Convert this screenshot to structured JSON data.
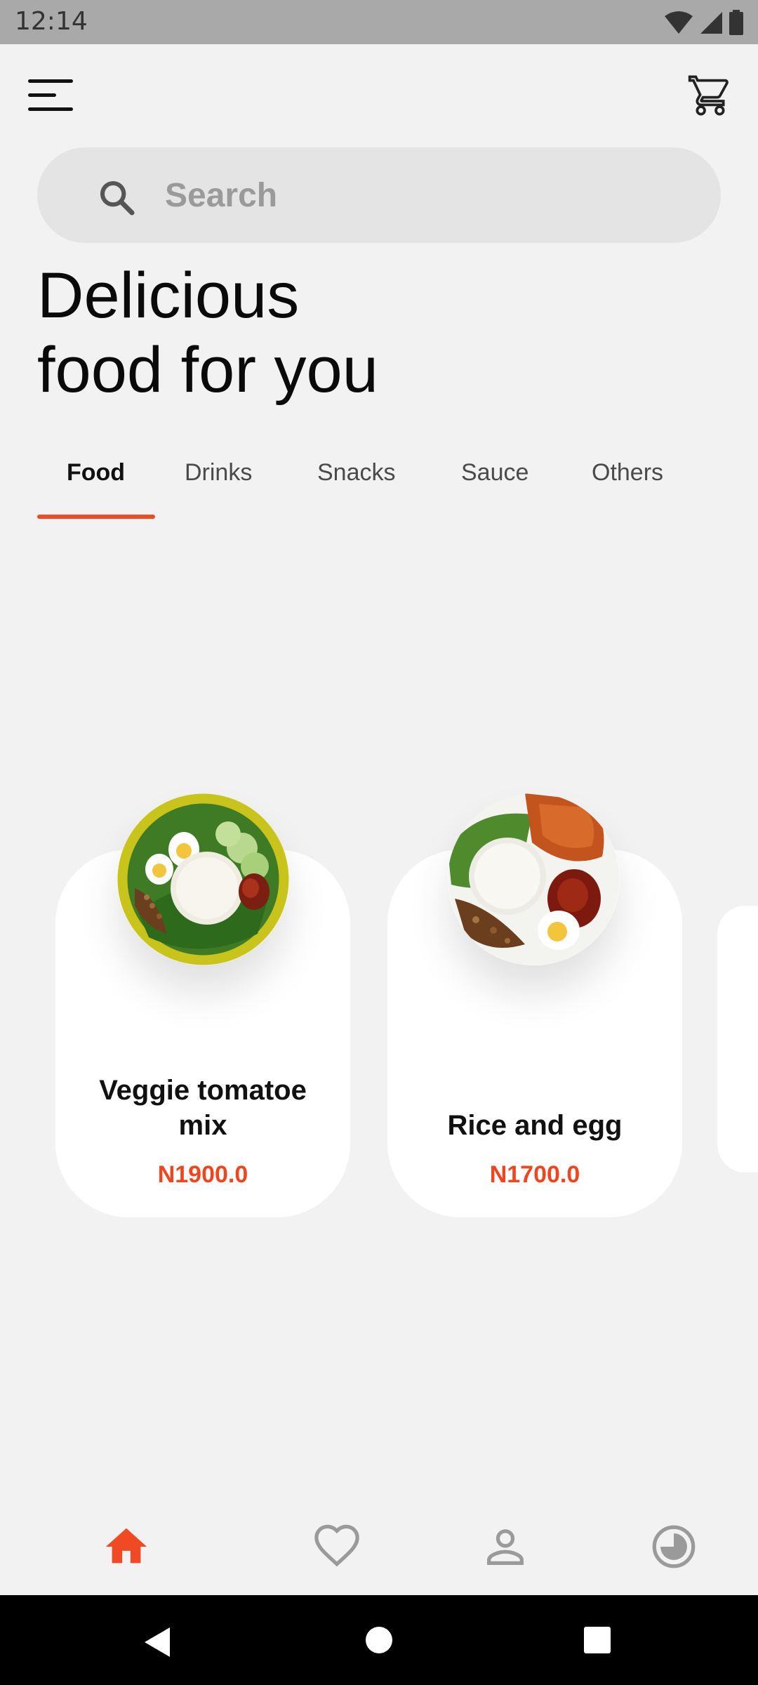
{
  "status_bar": {
    "time": "12:14",
    "icons": [
      "wifi-icon",
      "signal-icon",
      "battery-icon"
    ]
  },
  "header": {
    "menu_icon": "menu-icon",
    "cart_icon": "cart-icon"
  },
  "search": {
    "placeholder": "Search",
    "value": ""
  },
  "headline": {
    "line1": "Delicious",
    "line2": "food for you"
  },
  "tabs": [
    {
      "label": "Food",
      "active": true
    },
    {
      "label": "Drinks",
      "active": false
    },
    {
      "label": "Snacks",
      "active": false
    },
    {
      "label": "Sauce",
      "active": false
    },
    {
      "label": "Others",
      "active": false
    }
  ],
  "products": [
    {
      "name_line1": "Veggie tomatoe",
      "name_line2": "mix",
      "price": "N1900.0"
    },
    {
      "name_line1": "Rice and egg",
      "name_line2": "",
      "price": "N1700.0"
    }
  ],
  "bottom_nav": [
    {
      "icon": "home-icon",
      "active": true
    },
    {
      "icon": "heart-icon",
      "active": false
    },
    {
      "icon": "profile-icon",
      "active": false
    },
    {
      "icon": "history-icon",
      "active": false
    }
  ],
  "colors": {
    "accent": "#f04a24",
    "background": "#f2f2f2",
    "status_bar": "#a9a9a9"
  }
}
